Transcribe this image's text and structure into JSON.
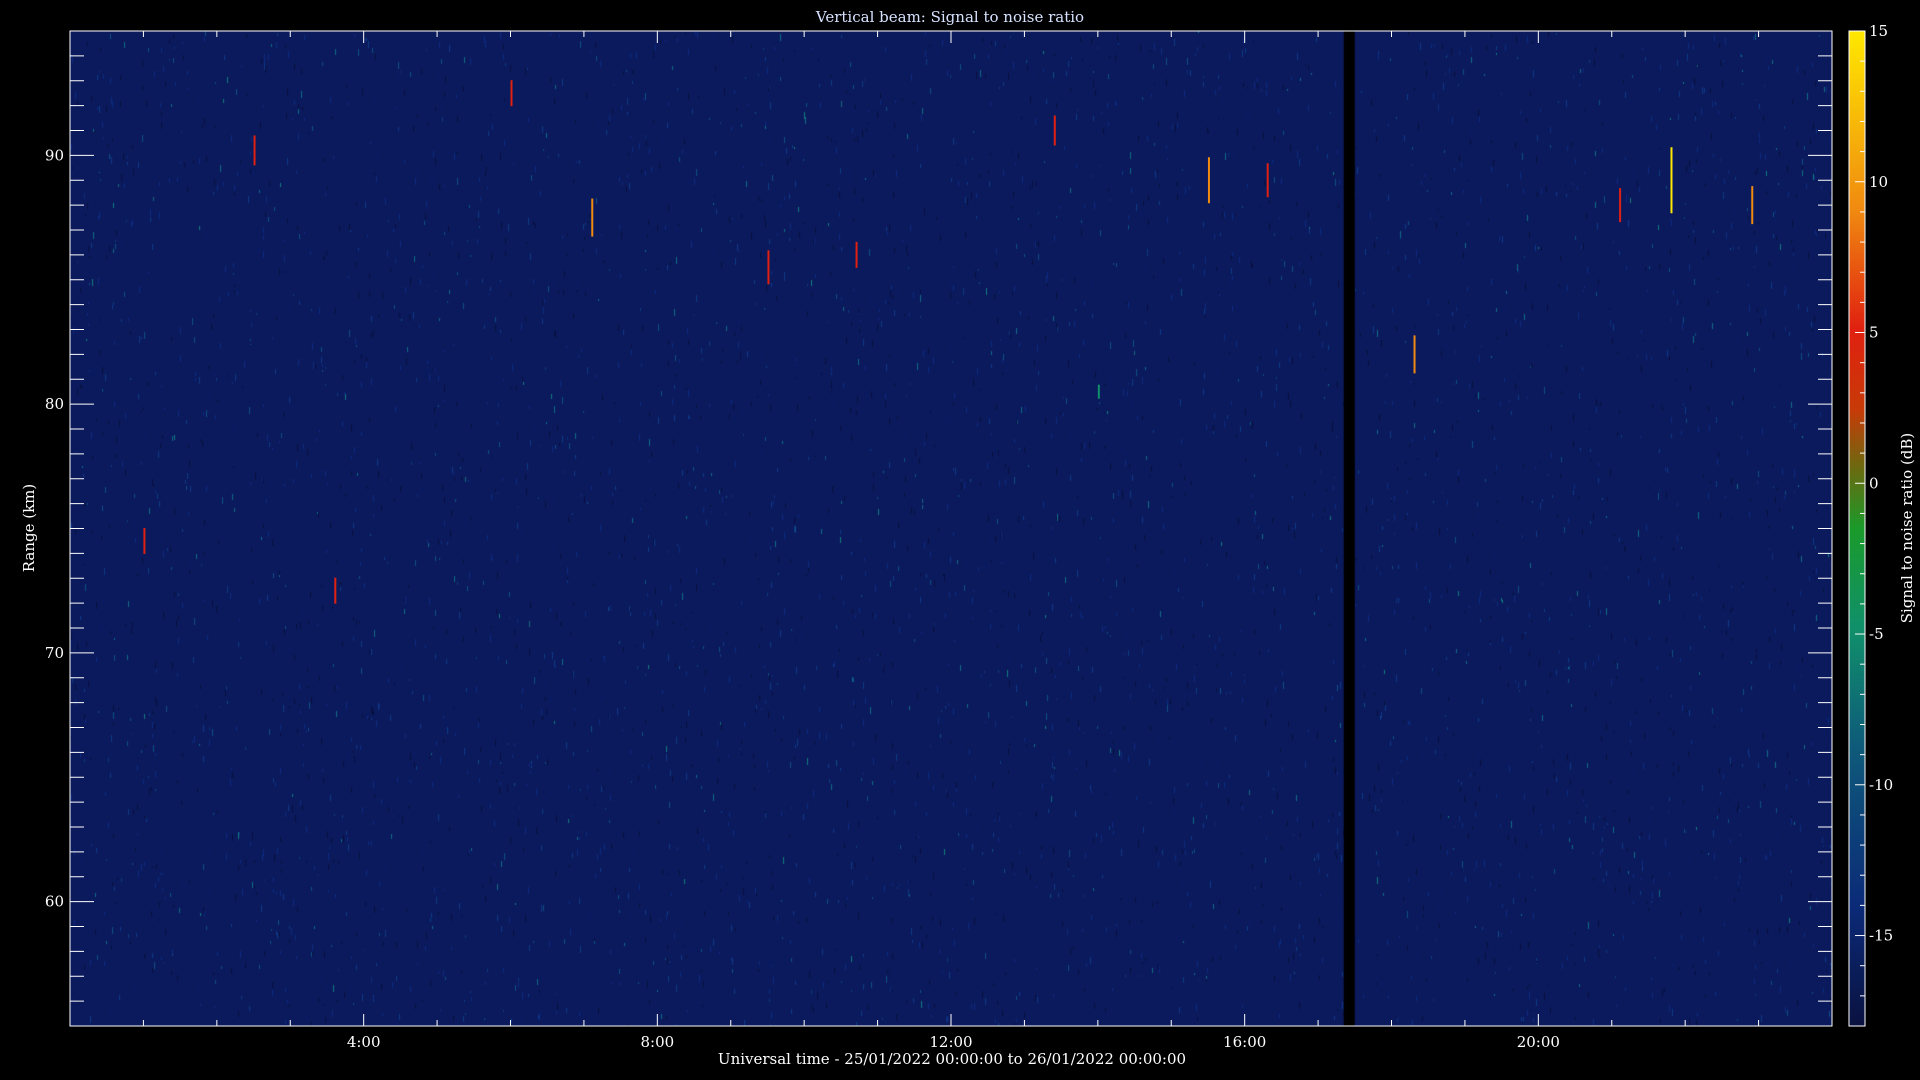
{
  "chart_data": {
    "type": "heatmap",
    "title": "Vertical beam: Signal to noise ratio",
    "xlabel": "Universal time - 25/01/2022 00:00:00 to 26/01/2022 00:00:00",
    "ylabel": "Range (km)",
    "colorbar_label": "Signal to noise ratio (dB)",
    "x_range_hours": [
      0,
      24
    ],
    "y_range_km": [
      55,
      95
    ],
    "colorbar_range_db": [
      -18,
      15
    ],
    "x_ticks": [
      {
        "value": 4,
        "label": "4:00"
      },
      {
        "value": 8,
        "label": "8:00"
      },
      {
        "value": 12,
        "label": "12:00"
      },
      {
        "value": 16,
        "label": "16:00"
      },
      {
        "value": 20,
        "label": "20:00"
      }
    ],
    "y_ticks": [
      {
        "value": 60,
        "label": "60"
      },
      {
        "value": 70,
        "label": "70"
      },
      {
        "value": 80,
        "label": "80"
      },
      {
        "value": 90,
        "label": "90"
      }
    ],
    "colorbar_ticks": [
      {
        "value": 15,
        "label": "15"
      },
      {
        "value": 10,
        "label": "10"
      },
      {
        "value": 5,
        "label": "5"
      },
      {
        "value": 0,
        "label": "0"
      },
      {
        "value": -5,
        "label": "-5"
      },
      {
        "value": -10,
        "label": "-10"
      },
      {
        "value": -15,
        "label": "-15"
      }
    ],
    "colormap": [
      "#0a1240",
      "#0b2a78",
      "#0e5a7a",
      "#10906a",
      "#1a9a2a",
      "#c85a08",
      "#e02010",
      "#f08a10",
      "#ffe800"
    ],
    "background_level_db": -16,
    "data_gaps_hours": [
      [
        17.35,
        17.5
      ]
    ],
    "notable_echoes": [
      {
        "time_h": 2.5,
        "range_km": 90.2,
        "snr_db": 4
      },
      {
        "time_h": 6.0,
        "range_km": 92.5,
        "snr_db": 3
      },
      {
        "time_h": 7.1,
        "range_km": 87.5,
        "snr_db": 6
      },
      {
        "time_h": 9.5,
        "range_km": 85.5,
        "snr_db": 5
      },
      {
        "time_h": 10.7,
        "range_km": 86.0,
        "snr_db": 3
      },
      {
        "time_h": 13.4,
        "range_km": 91.0,
        "snr_db": 4
      },
      {
        "time_h": 15.5,
        "range_km": 89.0,
        "snr_db": 8
      },
      {
        "time_h": 16.3,
        "range_km": 89.0,
        "snr_db": 5
      },
      {
        "time_h": 18.3,
        "range_km": 82.0,
        "snr_db": 6
      },
      {
        "time_h": 21.1,
        "range_km": 88.0,
        "snr_db": 5
      },
      {
        "time_h": 21.8,
        "range_km": 89.0,
        "snr_db": 13
      },
      {
        "time_h": 22.9,
        "range_km": 88.0,
        "snr_db": 6
      },
      {
        "time_h": 1.0,
        "range_km": 74.5,
        "snr_db": 3
      },
      {
        "time_h": 3.6,
        "range_km": 72.5,
        "snr_db": 3
      },
      {
        "time_h": 14.0,
        "range_km": 80.5,
        "snr_db": -5
      }
    ]
  }
}
